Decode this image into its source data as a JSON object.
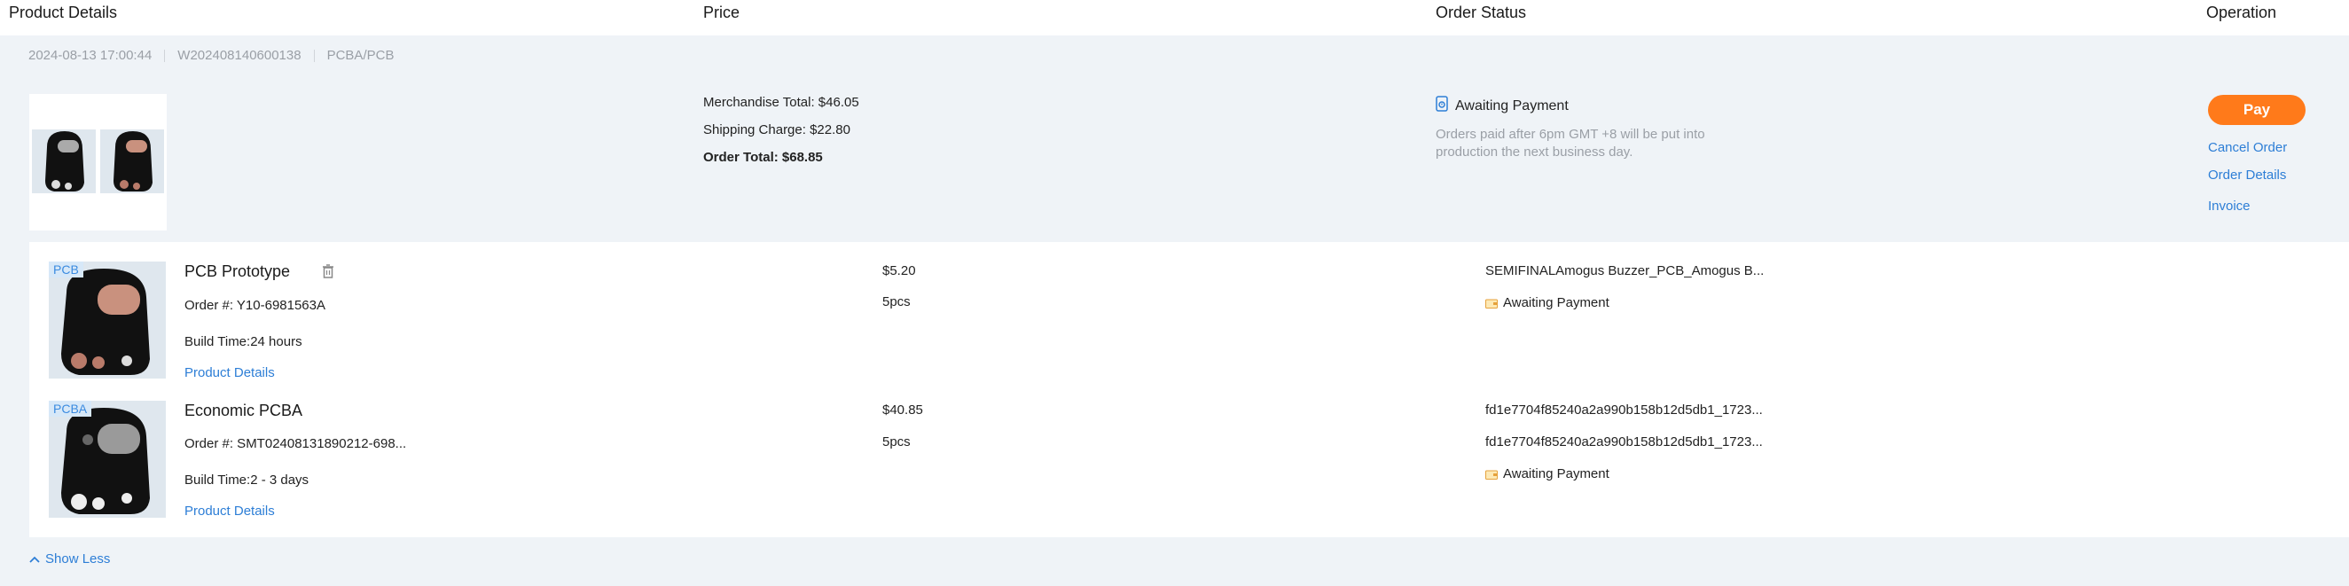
{
  "headers": {
    "product_details": "Product Details",
    "price": "Price",
    "order_status": "Order Status",
    "operation": "Operation"
  },
  "order": {
    "datetime": "2024-08-13 17:00:44",
    "order_no": "W202408140600138",
    "category": "PCBA/PCB",
    "merchandise_total": "Merchandise Total: $46.05",
    "shipping_charge": "Shipping Charge: $22.80",
    "order_total": "Order Total: $68.85",
    "status": "Awaiting Payment",
    "note": "Orders paid after 6pm GMT +8 will be put into production the next business day.",
    "actions": {
      "pay": "Pay",
      "cancel": "Cancel Order",
      "details": "Order Details",
      "invoice": "Invoice"
    }
  },
  "items": [
    {
      "tag": "PCB",
      "name": "PCB Prototype",
      "order_no": "Order #: Y10-6981563A",
      "build_time": "Build Time:24 hours",
      "details_link": "Product Details",
      "price": "$5.20",
      "qty": "5pcs",
      "file": "SEMIFINALAmogus Buzzer_PCB_Amogus B...",
      "status": "Awaiting Payment"
    },
    {
      "tag": "PCBA",
      "name": "Economic PCBA",
      "order_no": "Order #: SMT02408131890212-698...",
      "build_time": "Build Time:2 - 3 days",
      "details_link": "Product Details",
      "price": "$40.85",
      "qty": "5pcs",
      "file1": "fd1e7704f85240a2a990b158b12d5db1_1723...",
      "file2": "fd1e7704f85240a2a990b158b12d5db1_1723...",
      "status": "Awaiting Payment"
    }
  ],
  "footer": {
    "show_less": "Show Less"
  },
  "colors": {
    "accent": "#ff7a1a",
    "link": "#2d7ed6",
    "band": "#eff3f7",
    "muted": "#9a9fa6"
  }
}
